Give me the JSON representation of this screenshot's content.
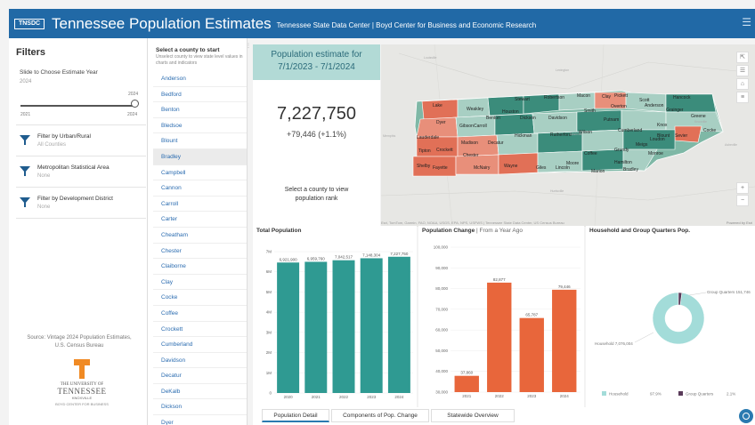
{
  "header": {
    "logo_text": "TNSDC",
    "title": "Tennessee Population Estimates",
    "subtitle": "Tennessee State Data Center | Boyd Center for Business and Economic Research",
    "menu_icon": "hamburger-icon"
  },
  "filters": {
    "title": "Filters",
    "slider_label": "Slide to Choose Estimate Year",
    "slider_value": "2024",
    "slider_max_label": "2024",
    "slider_min_tick": "2021",
    "slider_max_tick": "2024",
    "items": [
      {
        "label": "Filter by Urban/Rural",
        "value": "All Counties"
      },
      {
        "label": "Metropolitan Statistical Area",
        "value": "None"
      },
      {
        "label": "Filter by Development District",
        "value": "None"
      }
    ],
    "source": "Source: Vintage 2024 Population Estimates, U.S. Census Bureau",
    "logo": {
      "line1": "THE UNIVERSITY OF",
      "line2": "TENNESSEE",
      "line3": "KNOXVILLE",
      "line4": "BOYD CENTER FOR BUSINESS"
    }
  },
  "county_list": {
    "heading": "Select a county to start",
    "hint": "Unselect county to view state level values in charts and indicators",
    "selected": "Bradley",
    "items": [
      "Anderson",
      "Bedford",
      "Benton",
      "Bledsoe",
      "Blount",
      "Bradley",
      "Campbell",
      "Cannon",
      "Carroll",
      "Carter",
      "Cheatham",
      "Chester",
      "Claiborne",
      "Clay",
      "Cocke",
      "Coffee",
      "Crockett",
      "Cumberland",
      "Davidson",
      "Decatur",
      "DeKalb",
      "Dickson",
      "Dyer"
    ]
  },
  "population_card": {
    "heading": "Population estimate for 7/1/2023 - 7/1/2024",
    "value": "7,227,750",
    "change": "+79,446 (+1.1%)",
    "prompt": "Select a county to view population rank"
  },
  "map": {
    "attribution": "Esri, TomTom, Garmin, FAO, NOAA, USGS, EPA, NPS, USFWS | Tennessee State Data Center, US Census Bureau",
    "powered_by": "Powered by Esri",
    "colors": {
      "growth_high": "#3b8c7b",
      "growth_mid": "#a8cfc3",
      "decline": "#e88f7a",
      "decline_strong": "#e17057"
    },
    "controls": [
      "expand-icon",
      "legend-icon",
      "home-icon",
      "layers-icon",
      "zoom-in-icon",
      "zoom-out-icon"
    ],
    "county_labels": [
      {
        "name": "Lake"
      },
      {
        "name": "Weakley"
      },
      {
        "name": "Stewart"
      },
      {
        "name": "Robertson"
      },
      {
        "name": "Macon"
      },
      {
        "name": "Clay"
      },
      {
        "name": "Pickett"
      },
      {
        "name": "Scott"
      },
      {
        "name": "Hancock"
      },
      {
        "name": "Dyer"
      },
      {
        "name": "Gibson"
      },
      {
        "name": "Carroll"
      },
      {
        "name": "Benton"
      },
      {
        "name": "Houston"
      },
      {
        "name": "Dickson"
      },
      {
        "name": "Davidson"
      },
      {
        "name": "Smith"
      },
      {
        "name": "Overton"
      },
      {
        "name": "Grainger"
      },
      {
        "name": "Greene"
      },
      {
        "name": "Lauderdale"
      },
      {
        "name": "Crockett"
      },
      {
        "name": "Madison"
      },
      {
        "name": "Decatur"
      },
      {
        "name": "Hickman"
      },
      {
        "name": "Rutherford"
      },
      {
        "name": "Putnam"
      },
      {
        "name": "Cumberland"
      },
      {
        "name": "Loudon"
      },
      {
        "name": "Sevier"
      },
      {
        "name": "Cocke"
      },
      {
        "name": "Tipton"
      },
      {
        "name": "Chester"
      },
      {
        "name": "Shelby"
      },
      {
        "name": "Fayette"
      },
      {
        "name": "McNairy"
      },
      {
        "name": "Wayne"
      },
      {
        "name": "Giles"
      },
      {
        "name": "Lincoln"
      },
      {
        "name": "Coffee"
      },
      {
        "name": "Moore"
      },
      {
        "name": "Grundy"
      },
      {
        "name": "Marion"
      },
      {
        "name": "Bradley"
      },
      {
        "name": "Hamilton"
      },
      {
        "name": "Monroe"
      },
      {
        "name": "Wilson"
      },
      {
        "name": "Meigs"
      },
      {
        "name": "Anderson"
      },
      {
        "name": "Knox"
      },
      {
        "name": "Blount"
      }
    ],
    "cities": [
      "Louisville",
      "Lexington",
      "Memphis",
      "Nashville",
      "Knoxville",
      "Asheville",
      "Huntsville"
    ]
  },
  "charts": {
    "total_population": {
      "title": "Total Population"
    },
    "population_change": {
      "title": "Population Change",
      "title_suffix": " | From a Year Ago"
    },
    "household": {
      "title": "Household and Group Quarters Pop."
    }
  },
  "chart_data": [
    {
      "type": "bar",
      "title": "Total Population",
      "categories": [
        "2020",
        "2021",
        "2022",
        "2023",
        "2024"
      ],
      "values": [
        6921900,
        6959760,
        7042517,
        7148304,
        7227750
      ],
      "data_labels": [
        "6,921,900",
        "6,959,760",
        "7,042,517",
        "7,148,304",
        "7,227,750"
      ],
      "y_tick_labels": [
        "0",
        "1M",
        "2M",
        "3M",
        "4M",
        "5M",
        "6M",
        "7M"
      ],
      "ylim": [
        0,
        7500000
      ],
      "color": "#2f9a92"
    },
    {
      "type": "bar",
      "title": "Population Change",
      "subtitle": "From a Year Ago",
      "categories": [
        "2021",
        "2022",
        "2023",
        "2024"
      ],
      "values": [
        37860,
        82877,
        65787,
        79446
      ],
      "data_labels": [
        "37,860",
        "82,877",
        "65,787",
        "79,446"
      ],
      "y_tick_labels": [
        "30,000",
        "40,000",
        "50,000",
        "60,000",
        "70,000",
        "80,000",
        "90,000",
        "100,000"
      ],
      "ylim": [
        30000,
        100000
      ],
      "color": "#e8663b"
    },
    {
      "type": "pie",
      "title": "Household and Group Quarters Pop.",
      "slices": [
        {
          "name": "Household",
          "label": "Household 7,076,004",
          "value": 97.9,
          "legend": "97.9%",
          "color": "#a3dcd9"
        },
        {
          "name": "Group Quarters",
          "label": "Group Quarters 151,746",
          "value": 2.1,
          "legend": "2.1%",
          "color": "#5a3b5a"
        }
      ]
    }
  ],
  "tabs": [
    "Population Detail",
    "Components of Pop. Change",
    "Statewide Overview"
  ],
  "active_tab": 0
}
